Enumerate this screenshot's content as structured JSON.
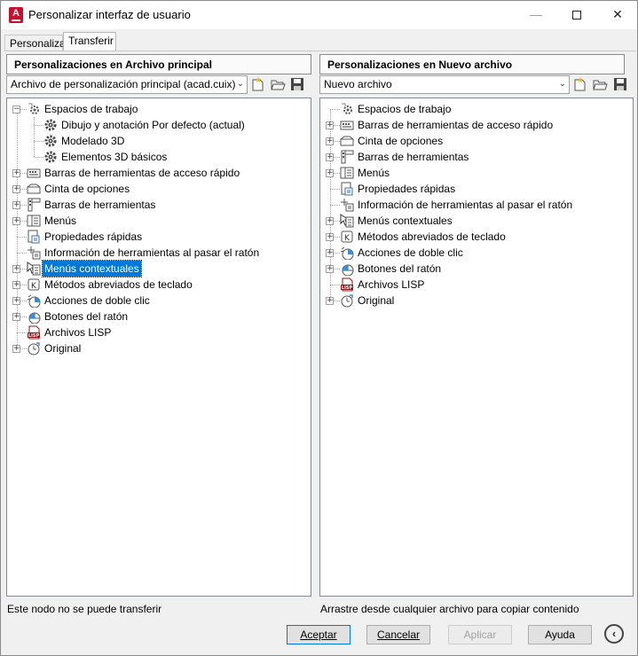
{
  "window": {
    "title": "Personalizar interfaz de usuario",
    "app_icon_letter": "A",
    "controls": [
      "minimize-icon",
      "maximize-icon",
      "close-icon"
    ]
  },
  "tabs": [
    {
      "label": "Personalizar",
      "active": false
    },
    {
      "label": "Transferir",
      "active": true
    }
  ],
  "left_panel": {
    "header": "Personalizaciones en Archivo principal",
    "file_select": "Archivo de personalización principal (acad.cuix)",
    "tree": [
      {
        "label": "Espacios de trabajo",
        "icon": "workspaces-icon",
        "expander": "minus",
        "selected": false
      },
      {
        "label": "Dibujo y anotación Por defecto (actual)",
        "icon": "workspace-gear-icon",
        "expander": "",
        "selected": false
      },
      {
        "label": "Modelado 3D",
        "icon": "workspace-gear-icon",
        "expander": "",
        "selected": false
      },
      {
        "label": "Elementos 3D básicos",
        "icon": "workspace-gear-icon",
        "expander": "",
        "selected": false
      },
      {
        "label": "Barras de herramientas de acceso rápido",
        "icon": "quick-access-toolbar-icon",
        "expander": "plus",
        "selected": false
      },
      {
        "label": "Cinta de opciones",
        "icon": "ribbon-icon",
        "expander": "plus",
        "selected": false
      },
      {
        "label": "Barras de herramientas",
        "icon": "toolbars-icon",
        "expander": "plus",
        "selected": false
      },
      {
        "label": "Menús",
        "icon": "menus-icon",
        "expander": "plus",
        "selected": false
      },
      {
        "label": "Propiedades rápidas",
        "icon": "quick-properties-icon",
        "expander": "",
        "selected": false
      },
      {
        "label": "Información de herramientas al pasar el ratón",
        "icon": "rollover-tooltips-icon",
        "expander": "",
        "selected": false
      },
      {
        "label": "Menús contextuales",
        "icon": "shortcut-menus-icon",
        "expander": "plus",
        "selected": true
      },
      {
        "label": "Métodos abreviados de teclado",
        "icon": "keyboard-shortcuts-icon",
        "expander": "plus",
        "selected": false
      },
      {
        "label": "Acciones de doble clic",
        "icon": "double-click-icon",
        "expander": "plus",
        "selected": false
      },
      {
        "label": "Botones del ratón",
        "icon": "mouse-buttons-icon",
        "expander": "plus",
        "selected": false
      },
      {
        "label": "Archivos LISP",
        "icon": "lisp-files-icon",
        "expander": "",
        "selected": false
      },
      {
        "label": "Original",
        "icon": "legacy-icon",
        "expander": "plus",
        "selected": false
      }
    ],
    "status": "Este nodo no se puede transferir"
  },
  "right_panel": {
    "header": "Personalizaciones en Nuevo archivo",
    "file_select": "Nuevo archivo",
    "tree": [
      {
        "label": "Espacios de trabajo",
        "icon": "workspaces-icon",
        "expander": "",
        "selected": false
      },
      {
        "label": "Barras de herramientas de acceso rápido",
        "icon": "quick-access-toolbar-icon",
        "expander": "plus",
        "selected": false
      },
      {
        "label": "Cinta de opciones",
        "icon": "ribbon-icon",
        "expander": "plus",
        "selected": false
      },
      {
        "label": "Barras de herramientas",
        "icon": "toolbars-icon",
        "expander": "plus",
        "selected": false
      },
      {
        "label": "Menús",
        "icon": "menus-icon",
        "expander": "plus",
        "selected": false
      },
      {
        "label": "Propiedades rápidas",
        "icon": "quick-properties-icon",
        "expander": "",
        "selected": false
      },
      {
        "label": "Información de herramientas al pasar el ratón",
        "icon": "rollover-tooltips-icon",
        "expander": "",
        "selected": false
      },
      {
        "label": "Menús contextuales",
        "icon": "shortcut-menus-icon",
        "expander": "plus",
        "selected": false
      },
      {
        "label": "Métodos abreviados de teclado",
        "icon": "keyboard-shortcuts-icon",
        "expander": "plus",
        "selected": false
      },
      {
        "label": "Acciones de doble clic",
        "icon": "double-click-icon",
        "expander": "plus",
        "selected": false
      },
      {
        "label": "Botones del ratón",
        "icon": "mouse-buttons-icon",
        "expander": "plus",
        "selected": false
      },
      {
        "label": "Archivos LISP",
        "icon": "lisp-files-icon",
        "expander": "",
        "selected": false
      },
      {
        "label": "Original",
        "icon": "legacy-icon",
        "expander": "plus",
        "selected": false
      }
    ],
    "status": "Arrastre desde cualquier archivo para copiar contenido"
  },
  "toolbar_icons": [
    "new-file-icon",
    "open-file-icon",
    "save-file-icon"
  ],
  "buttons": {
    "accept": "Aceptar",
    "cancel": "Cancelar",
    "apply": "Aplicar",
    "help": "Ayuda"
  },
  "colors": {
    "selection": "#0078d7",
    "app_icon": "#c8102e"
  }
}
